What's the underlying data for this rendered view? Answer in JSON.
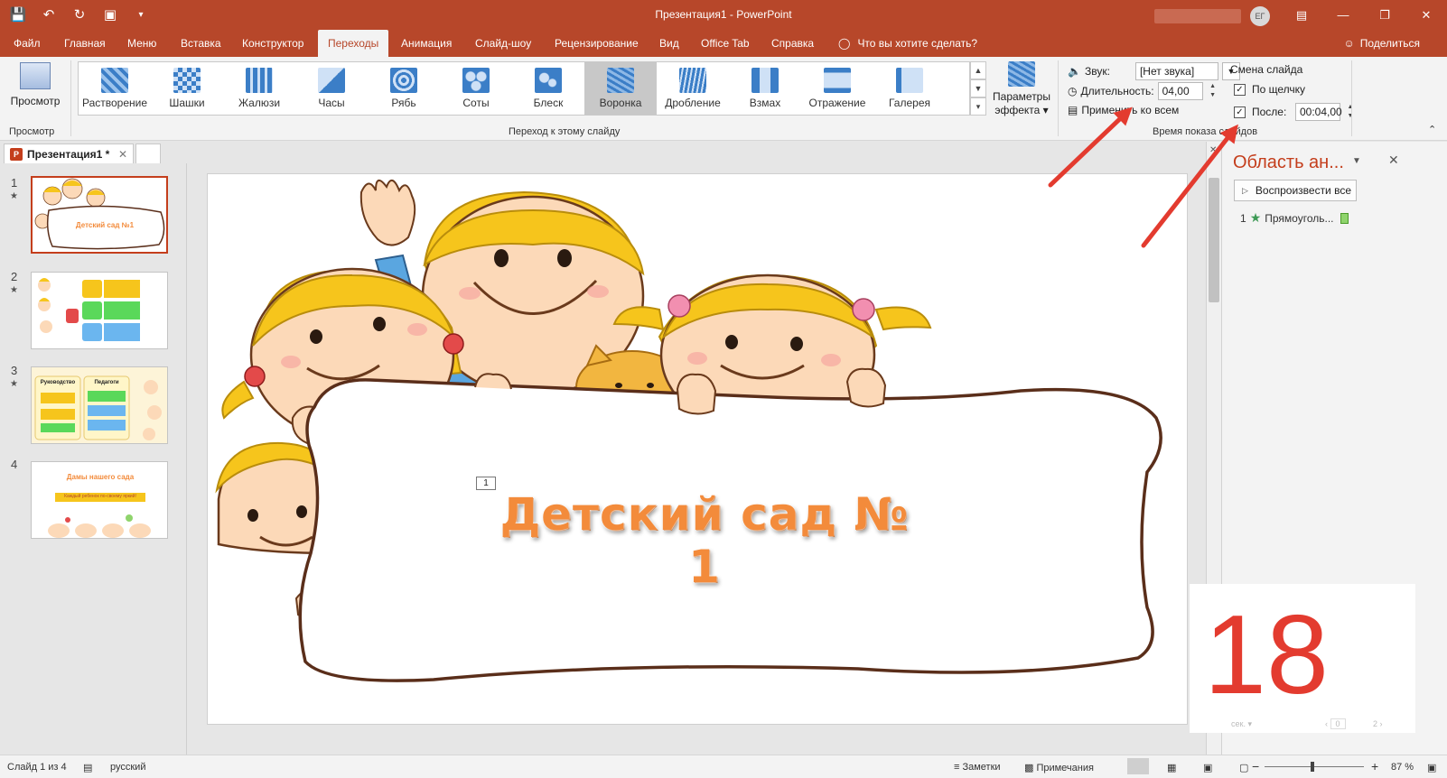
{
  "window": {
    "title": "Презентация1  -  PowerPoint",
    "user_initials": "ЕГ"
  },
  "menu_tabs": [
    {
      "label": "Файл"
    },
    {
      "label": "Главная"
    },
    {
      "label": "Меню"
    },
    {
      "label": "Вставка"
    },
    {
      "label": "Конструктор"
    },
    {
      "label": "Переходы"
    },
    {
      "label": "Анимация"
    },
    {
      "label": "Слайд-шоу"
    },
    {
      "label": "Рецензирование"
    },
    {
      "label": "Вид"
    },
    {
      "label": "Office Tab"
    },
    {
      "label": "Справка"
    },
    {
      "label": "Что вы хотите сделать?"
    }
  ],
  "active_tab": "Переходы",
  "share_label": "Поделиться",
  "ribbon": {
    "preview_label": "Просмотр",
    "preview_group_label": "Просмотр",
    "transition_group_label": "Переход к этому слайду",
    "transitions": [
      {
        "label": "Растворение",
        "icon": "dissolve-icon",
        "color": "#3b7ec7"
      },
      {
        "label": "Шашки",
        "icon": "checkerboard-icon",
        "color": "#3b7ec7"
      },
      {
        "label": "Жалюзи",
        "icon": "blinds-icon",
        "color": "#3b7ec7"
      },
      {
        "label": "Часы",
        "icon": "clock-icon",
        "color": "#3b7ec7"
      },
      {
        "label": "Рябь",
        "icon": "ripple-icon",
        "color": "#3b7ec7"
      },
      {
        "label": "Соты",
        "icon": "honeycomb-icon",
        "color": "#3b7ec7"
      },
      {
        "label": "Блеск",
        "icon": "glitter-icon",
        "color": "#3b7ec7"
      },
      {
        "label": "Воронка",
        "icon": "vortex-icon",
        "color": "#3b7ec7"
      },
      {
        "label": "Дробление",
        "icon": "shred-icon",
        "color": "#3b7ec7"
      },
      {
        "label": "Взмах",
        "icon": "switch-icon",
        "color": "#3b7ec7"
      },
      {
        "label": "Отражение",
        "icon": "flip-icon",
        "color": "#3b7ec7"
      },
      {
        "label": "Галерея",
        "icon": "gallery-icon",
        "color": "#3b7ec7"
      }
    ],
    "selected_transition": "Воронка",
    "effect_options_line1": "Параметры",
    "effect_options_line2": "эффекта",
    "timing_group_label": "Время показа слайдов",
    "sound_label": "Звук:",
    "sound_value": "[Нет звука]",
    "duration_label": "Длительность:",
    "duration_value": "04,00",
    "apply_all_label": "Применить ко всем",
    "advance_label": "Смена слайда",
    "on_click_label": "По щелчку",
    "on_click_checked": true,
    "after_label": "После:",
    "after_checked": true,
    "after_value": "00:04,00"
  },
  "doc_tab": {
    "label": "Презентация1 *",
    "icon_letter": "P"
  },
  "thumbnails": [
    {
      "number": "1",
      "star": "★",
      "caption": "Детский сад №1"
    },
    {
      "number": "2",
      "star": "★",
      "caption": ""
    },
    {
      "number": "3",
      "star": "★",
      "caption": "",
      "header_a": "Руководство",
      "header_b": "Педагоги"
    },
    {
      "number": "4",
      "star": "",
      "caption": "Дамы нашего сада",
      "subcaption": "Каждый ребенок по-своему яркий!"
    }
  ],
  "slide": {
    "title": "Детский сад № 1",
    "anim_tag": "1"
  },
  "animation_pane": {
    "title": "Область ан...",
    "play_all_label": "Воспроизвести все",
    "item_number": "1",
    "item_label": "Прямоуголь...",
    "big_number": "18",
    "sec_label": "сек.",
    "pager_a": "0",
    "pager_b": "2"
  },
  "status": {
    "slide_info": "Слайд 1 из 4",
    "language": "русский",
    "notes_label": "Заметки",
    "comments_label": "Примечания",
    "zoom": "87 %"
  },
  "colors": {
    "accent": "#b7472a",
    "annotation_arrow": "#e33b2f",
    "title_orange": "#f38b3b"
  }
}
